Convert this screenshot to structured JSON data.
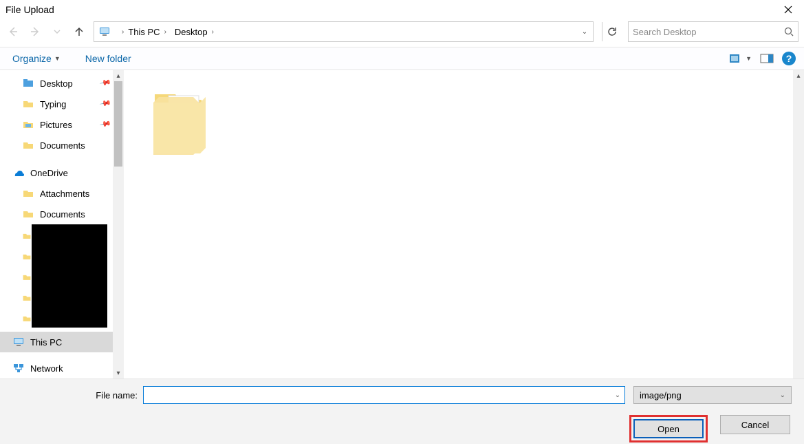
{
  "title": "File Upload",
  "breadcrumbs": {
    "item0": "This PC",
    "item1": "Desktop"
  },
  "search": {
    "placeholder": "Search Desktop"
  },
  "toolbar": {
    "organize": "Organize",
    "new_folder": "New folder"
  },
  "sidebar": {
    "items": {
      "desktop": "Desktop",
      "typing": "Typing",
      "pictures": "Pictures",
      "documents": "Documents",
      "onedrive": "OneDrive",
      "attachments": "Attachments",
      "od_documents": "Documents",
      "this_pc": "This PC",
      "network": "Network"
    }
  },
  "footer": {
    "file_name_label": "File name:",
    "file_name_value": "",
    "filter_label": "image/png",
    "open_label": "Open",
    "cancel_label": "Cancel"
  }
}
